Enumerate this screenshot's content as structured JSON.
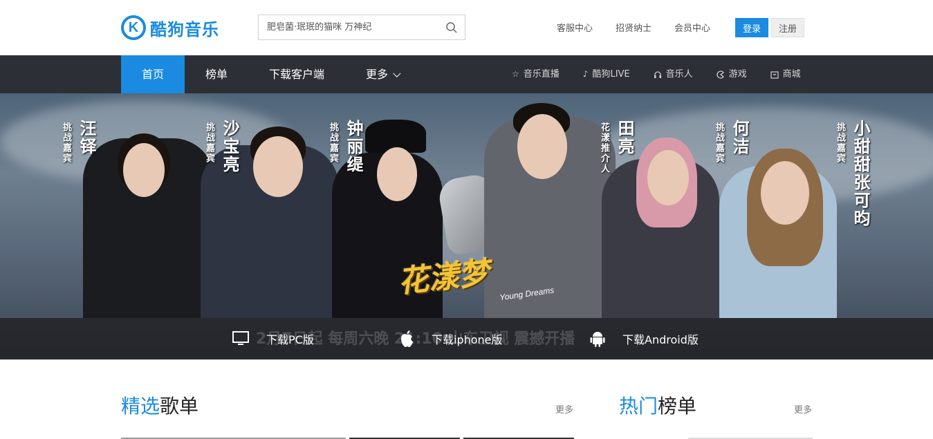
{
  "header": {
    "logo_letter": "K",
    "logo_text": "酷狗音乐",
    "search_placeholder": "肥皂菌·珉珉的猫咪 万神纪",
    "links": [
      "客服中心",
      "招贤纳士",
      "会员中心"
    ],
    "login_label": "登录",
    "register_label": "注册"
  },
  "nav": {
    "items": [
      {
        "label": "首页",
        "active": true
      },
      {
        "label": "榜单",
        "active": false
      },
      {
        "label": "下载客户端",
        "active": false
      },
      {
        "label": "更多",
        "active": false
      }
    ],
    "sub_items": [
      {
        "label": "音乐直播",
        "icon": "star-icon"
      },
      {
        "label": "酷狗LIVE",
        "icon": "music-note-icon"
      },
      {
        "label": "音乐人",
        "icon": "headphones-icon"
      },
      {
        "label": "游戏",
        "icon": "game-icon"
      },
      {
        "label": "商城",
        "icon": "shop-icon"
      }
    ]
  },
  "banner": {
    "show_title": "花漾梦",
    "show_subtitle": "Young Dreams",
    "bottom_ghost_text": "2月7日起 每周六晚 21:10 山东卫视 震撼开播",
    "guests": [
      {
        "role": "挑战嘉宾",
        "name": "汪铎"
      },
      {
        "role": "挑战嘉宾",
        "name": "沙宝亮"
      },
      {
        "role": "挑战嘉宾",
        "name": "钟丽缇"
      },
      {
        "role": "花漾推介人",
        "name": "田亮"
      },
      {
        "role": "挑战嘉宾",
        "name": "何洁"
      },
      {
        "role": "挑战嘉宾",
        "name": "小甜甜张可昀"
      }
    ],
    "downloads": [
      {
        "label": "下载PC版",
        "icon": "monitor-icon"
      },
      {
        "label": "下载iphone版",
        "icon": "apple-icon"
      },
      {
        "label": "下载Android版",
        "icon": "android-icon"
      }
    ]
  },
  "sections": {
    "playlists": {
      "accent": "精选",
      "rest": "歌单",
      "more": "更多"
    },
    "charts": {
      "accent": "热门",
      "rest": "榜单",
      "more": "更多"
    }
  },
  "colors": {
    "brand": "#1a8be0",
    "nav_bg": "#2c2f36"
  }
}
